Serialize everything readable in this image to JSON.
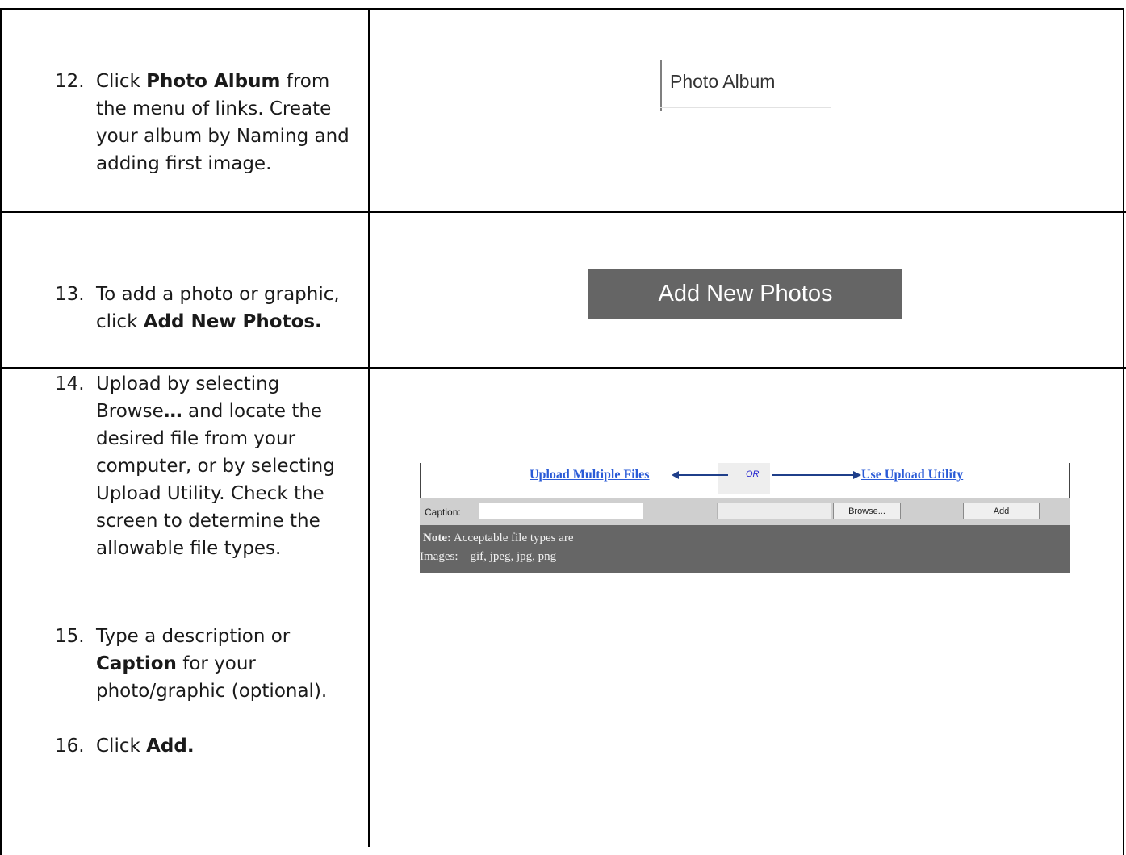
{
  "steps": [
    {
      "num": "12.",
      "lines": [
        "Click ",
        "Photo Album",
        " from",
        "the menu of links. Create",
        "your album by Naming and",
        "adding first image."
      ]
    },
    {
      "num": "13.",
      "lines": [
        "To add a photo or graphic,",
        "click ",
        "Add New Photos."
      ]
    },
    {
      "num": "14.",
      "lines": [
        "Upload by selecting",
        "Browse",
        "…",
        " and locate the",
        "desired file from your",
        "computer, or by selecting",
        "Upload Utility.  Check the",
        "screen to determine the",
        "allowable file types."
      ]
    },
    {
      "num": "15.",
      "lines": [
        "Type a description or",
        "Caption",
        " for your",
        "photo/graphic (optional)."
      ]
    },
    {
      "num": "16.",
      "lines": [
        "Click ",
        "Add."
      ]
    }
  ],
  "photo_album": {
    "label": "Photo Album"
  },
  "add_new_photos": {
    "label": "Add New Photos"
  },
  "upload": {
    "multiple_files": "Upload Multiple Files",
    "or": "OR",
    "utility": "Use Upload Utility",
    "caption_label": "Caption:",
    "browse": "Browse...",
    "add": "Add",
    "note_bold": "Note:",
    "note_text": " Acceptable file types are",
    "types": "Images:    gif, jpeg, jpg, png"
  }
}
